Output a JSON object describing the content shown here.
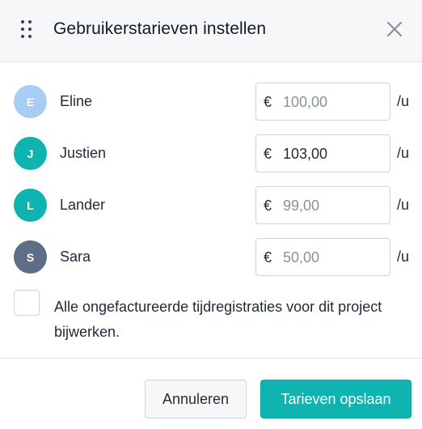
{
  "dialog": {
    "title": "Gebruikerstarieven instellen",
    "drag_icon": "drag-handle-icon",
    "close_icon": "close-icon"
  },
  "users": [
    {
      "initial": "E",
      "name": "Eline",
      "avatar_color": "#a8cdf5",
      "currency": "€",
      "value": "",
      "placeholder": "100,00",
      "unit": "/u"
    },
    {
      "initial": "J",
      "name": "Justien",
      "avatar_color": "#0fb3b0",
      "currency": "€",
      "value": "103,00",
      "placeholder": "",
      "unit": "/u"
    },
    {
      "initial": "L",
      "name": "Lander",
      "avatar_color": "#0fb3b0",
      "currency": "€",
      "value": "",
      "placeholder": "99,00",
      "unit": "/u"
    },
    {
      "initial": "S",
      "name": "Sara",
      "avatar_color": "#5e6e86",
      "currency": "€",
      "value": "",
      "placeholder": "50,00",
      "unit": "/u"
    }
  ],
  "update_unbilled": {
    "checked": false,
    "label": "Alle ongefactureerde tijdregistraties voor dit project bijwerken."
  },
  "footer": {
    "cancel_label": "Annuleren",
    "save_label": "Tarieven opslaan"
  },
  "colors": {
    "accent": "#0fb3b0",
    "header_bg": "#f6f7f8"
  }
}
